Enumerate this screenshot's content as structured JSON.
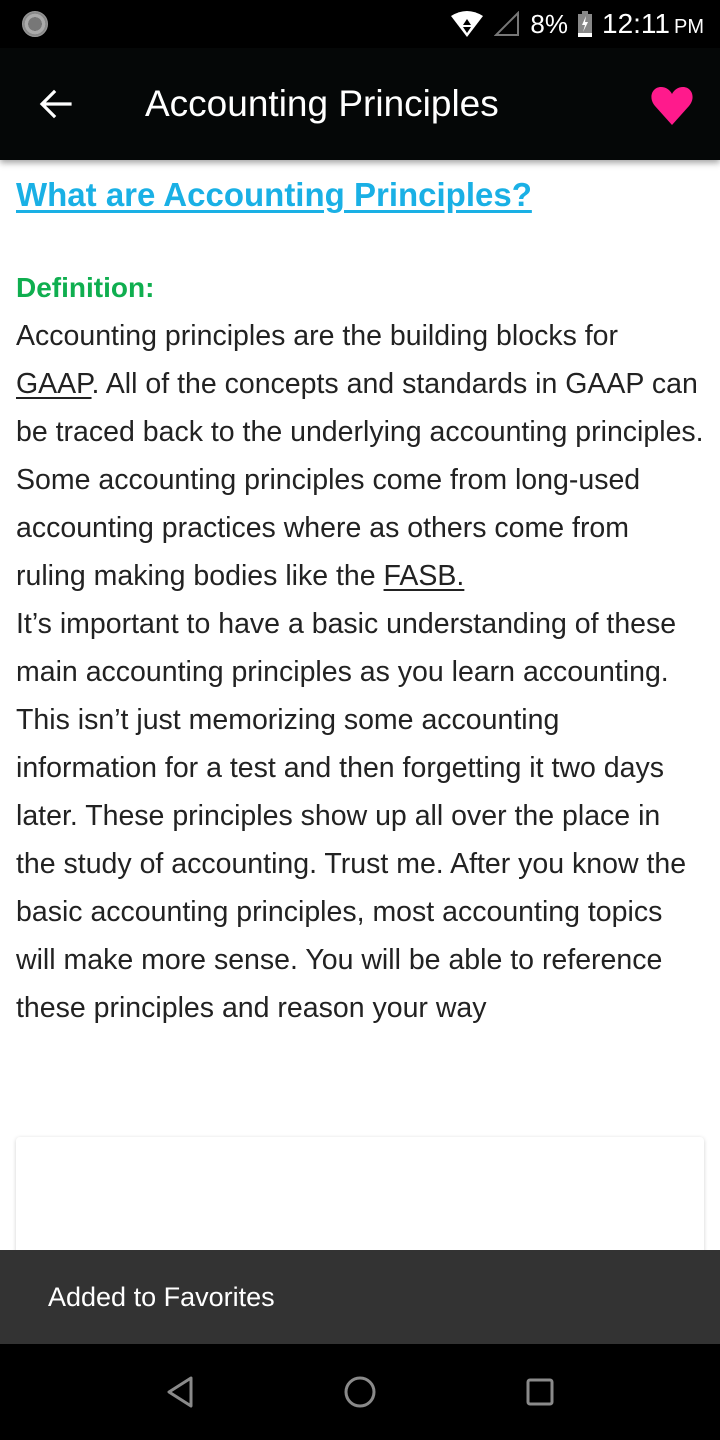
{
  "status_bar": {
    "battery_percent": "8%",
    "time": "12:11",
    "ampm": "PM",
    "icons": [
      "sync-icon",
      "wifi-icon",
      "cell-signal-icon",
      "battery-charging-icon"
    ]
  },
  "app_bar": {
    "title": "Accounting Principles",
    "back_icon": "arrow-left-icon",
    "favorite_icon": "heart-icon",
    "favorite_color": "#ff1a8c"
  },
  "article": {
    "heading": "What are Accounting Principles?",
    "definition_label": "Definition:",
    "para1": {
      "t1": "Accounting principles are the building blocks for ",
      "link1": "GAAP",
      "t2": ". All of the concepts and standards in GAAP can be traced back to the underlying accounting principles. Some accounting principles come from long-used accounting practices where as others come from ruling making bodies like the ",
      "link2": "FASB."
    },
    "para2": "It’s important to have a basic understanding of these main accounting principles as you learn accounting. This isn’t just memorizing some accounting information for a test and then forgetting it two days later. These principles show up all over the place in the study of accounting. Trust me. After you know the basic accounting principles, most accounting topics will make more sense. You will be able to reference these principles and reason your way",
    "heading_color": "#1ab0e5",
    "definition_color": "#0fae4f"
  },
  "snackbar": {
    "message": "Added to Favorites"
  },
  "nav_bar": {
    "buttons": [
      "back-triangle-icon",
      "home-circle-icon",
      "recents-square-icon"
    ]
  }
}
